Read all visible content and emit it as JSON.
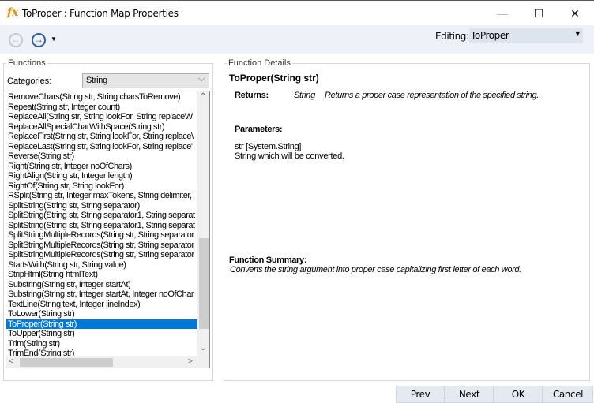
{
  "window": {
    "title": "ToProper : Function Map Properties",
    "icon": "fx-icon"
  },
  "toolbar": {
    "editing_label": "Editing:",
    "editing_value": "ToProper"
  },
  "functions": {
    "group_label": "Functions",
    "categories_label": "Categories:",
    "category": "String",
    "items": [
      "RemoveChars(String str, String charsToRemove)",
      "Repeat(String str, Integer count)",
      "ReplaceAll(String str, String lookFor, String replaceW",
      "ReplaceAllSpecialCharWithSpace(String str)",
      "ReplaceFirst(String str, String lookFor, String replace\\",
      "ReplaceLast(String str, String lookFor, String replace'",
      "Reverse(String str)",
      "Right(String str, Integer noOfChars)",
      "RightAlign(String str, Integer length)",
      "RightOf(String str, String lookFor)",
      "RSplit(String str, Integer maxTokens, String delimiter,",
      "SplitString(String str, String separator)",
      "SplitString(String str, String separator1, String separat",
      "SplitString(String str, String separator1, String separat",
      "SplitStringMultipleRecords(String str, String separator",
      "SplitStringMultipleRecords(String str, String separator",
      "SplitStringMultipleRecords(String str, String separator",
      "StartsWith(String str, String value)",
      "StripHtml(String htmlText)",
      "Substring(String str, Integer startAt)",
      "Substring(String str, Integer startAt, Integer noOfChar",
      "TextLine(String text, Integer lineIndex)",
      "ToLower(String str)",
      "ToProper(String str)",
      "ToUpper(String str)",
      "Trim(String str)",
      "TrimEnd(String str)"
    ],
    "selected_index": 23
  },
  "details": {
    "group_label": "Function Details",
    "signature": "ToProper(String str)",
    "returns_label": "Returns:",
    "returns_type": "String",
    "returns_desc": "Returns a proper case representation of the specified string.",
    "parameters_label": "Parameters:",
    "param_name": "str [System.String]",
    "param_desc": "String which will be converted.",
    "summary_label": "Function Summary:",
    "summary_desc": "Converts the string argument into proper case capitalizing first letter of each word."
  },
  "buttons": {
    "prev": "Prev",
    "next": "Next",
    "ok": "OK",
    "cancel": "Cancel"
  }
}
